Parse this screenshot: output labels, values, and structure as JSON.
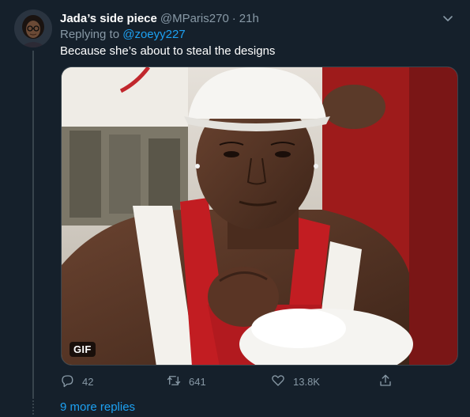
{
  "tweet": {
    "display_name": "Jada’s side piece",
    "handle": "@MParis270",
    "separator": "·",
    "time": "21h",
    "replying_prefix": "Replying to",
    "replying_to": "@zoeyy227",
    "text": "Because she’s about to steal the designs",
    "media_badge": "GIF"
  },
  "actions": {
    "reply_count": "42",
    "retweet_count": "641",
    "like_count": "13.8K"
  },
  "thread": {
    "more_replies": "9 more replies"
  },
  "icons": {
    "avatar": "avatar",
    "menu": "chevron-down-icon",
    "reply": "reply-icon",
    "retweet": "retweet-icon",
    "like": "heart-icon",
    "share": "share-icon"
  },
  "colors": {
    "background": "#15202b",
    "secondary_text": "#8899a6",
    "link": "#1da1f2",
    "border": "#38444d"
  }
}
